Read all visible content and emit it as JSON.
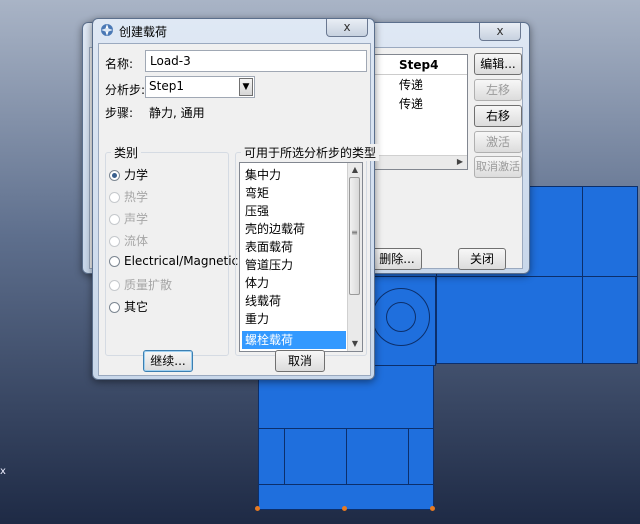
{
  "create_load_dialog": {
    "title": "创建载荷",
    "name_label": "名称:",
    "name_value": "Load-3",
    "step_label": "分析步:",
    "step_value": "Step1",
    "procedure_label": "步骤:",
    "procedure_value": "静力, 通用",
    "category_title": "类别",
    "categories": [
      {
        "label": "力学",
        "selected": true,
        "enabled": true
      },
      {
        "label": "热学",
        "selected": false,
        "enabled": false
      },
      {
        "label": "声学",
        "selected": false,
        "enabled": false
      },
      {
        "label": "流体",
        "selected": false,
        "enabled": false
      },
      {
        "label": "Electrical/Magnetic",
        "selected": false,
        "enabled": true
      },
      {
        "label": "质量扩散",
        "selected": false,
        "enabled": false
      },
      {
        "label": "其它",
        "selected": false,
        "enabled": true
      }
    ],
    "types_title": "可用于所选分析步的类型",
    "types": [
      "集中力",
      "弯矩",
      "压强",
      "壳的边载荷",
      "表面载荷",
      "管道压力",
      "体力",
      "线载荷",
      "重力",
      "螺栓载荷"
    ],
    "selected_type": "螺栓载荷",
    "continue_label": "继续...",
    "cancel_label": "取消"
  },
  "load_manager": {
    "column_header": "Step4",
    "rows": [
      "传递",
      "传递"
    ],
    "edit_label": "编辑...",
    "move_left_label": "左移",
    "move_right_label": "右移",
    "activate_label": "激活",
    "deactivate_label": "取消激活",
    "delete_label": "删除...",
    "close_label": "关闭"
  },
  "close_glyph": "x",
  "viewport": {
    "triad_text": "x"
  }
}
